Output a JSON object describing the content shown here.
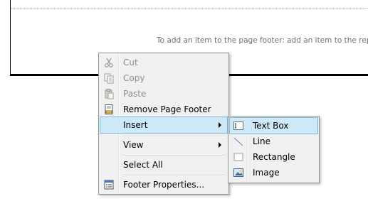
{
  "footer": {
    "hint": "To add an item to the page footer: add an item to the report"
  },
  "context_menu": {
    "items": [
      {
        "label": "Cut",
        "icon": "scissors-icon",
        "disabled": true
      },
      {
        "label": "Copy",
        "icon": "copy-icon",
        "disabled": true
      },
      {
        "label": "Paste",
        "icon": "paste-icon",
        "disabled": true
      },
      {
        "label": "Remove Page Footer",
        "icon": "remove-footer-icon",
        "disabled": false
      },
      {
        "label": "Insert",
        "icon": "",
        "submenu": true,
        "selected": true
      },
      {
        "label": "View",
        "icon": "",
        "submenu": true
      },
      {
        "label": "Select All",
        "icon": ""
      },
      {
        "label": "Footer Properties...",
        "icon": "properties-icon"
      }
    ]
  },
  "insert_submenu": {
    "items": [
      {
        "label": "Text Box",
        "icon": "textbox-icon",
        "selected": true
      },
      {
        "label": "Line",
        "icon": "line-icon"
      },
      {
        "label": "Rectangle",
        "icon": "rectangle-icon"
      },
      {
        "label": "Image",
        "icon": "image-icon"
      }
    ]
  },
  "colors": {
    "selection_bg": "#cde8f7",
    "selection_border": "#7bb6dc",
    "menu_bg": "#f0f0f0",
    "disabled_text": "#8d8d8d"
  }
}
